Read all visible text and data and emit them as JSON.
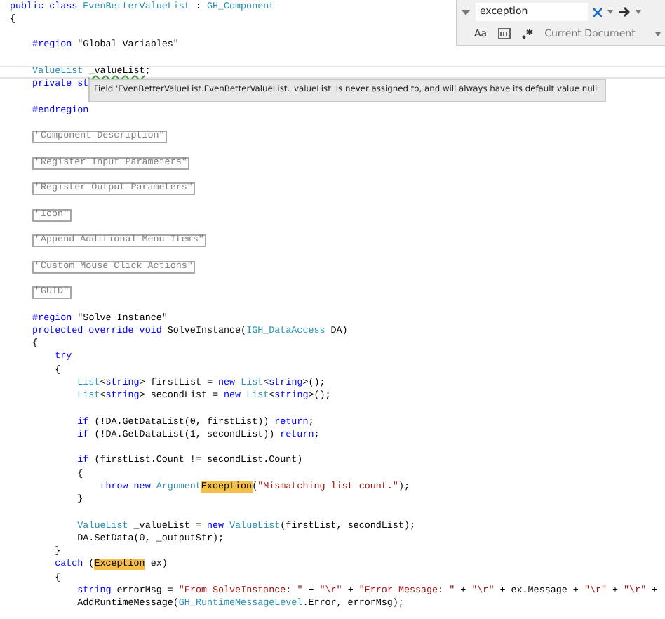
{
  "editor": {
    "lines": [
      {
        "tokens": [
          {
            "kind": "kw",
            "text": "public class "
          },
          {
            "kind": "type",
            "text": "EvenBetterValueList"
          },
          {
            "kind": "plain",
            "text": " : "
          },
          {
            "kind": "type",
            "text": "GH_Component"
          }
        ]
      },
      {
        "tokens": [
          {
            "kind": "plain",
            "text": "{"
          }
        ]
      },
      {
        "kind": "blank"
      },
      {
        "tokens": [
          {
            "kind": "kw",
            "text": "    #region "
          },
          {
            "kind": "plain",
            "text": "\"Global Variables\""
          }
        ]
      },
      {
        "kind": "blank"
      },
      {
        "current": true,
        "tokens": [
          {
            "kind": "type",
            "text": "    ValueList "
          },
          {
            "kind": "warn",
            "text": "_valueList"
          },
          {
            "kind": "plain",
            "text": ";"
          }
        ]
      },
      {
        "tokens": [
          {
            "kind": "kw",
            "text": "    private st"
          }
        ]
      },
      {
        "kind": "blank"
      },
      {
        "tokens": [
          {
            "kind": "kw",
            "text": "    #endregion"
          }
        ]
      },
      {
        "kind": "blank"
      },
      {
        "tokens": [
          {
            "kind": "collapsed",
            "text": "\"Component Description\""
          }
        ]
      },
      {
        "kind": "blank"
      },
      {
        "tokens": [
          {
            "kind": "collapsed",
            "text": "\"Register Input Parameters\""
          }
        ]
      },
      {
        "kind": "blank"
      },
      {
        "tokens": [
          {
            "kind": "collapsed",
            "text": "\"Register Output Parameters\""
          }
        ]
      },
      {
        "kind": "blank"
      },
      {
        "tokens": [
          {
            "kind": "collapsed",
            "text": "\"Icon\""
          }
        ]
      },
      {
        "kind": "blank"
      },
      {
        "tokens": [
          {
            "kind": "collapsed",
            "text": "\"Append Additional Menu Items\""
          }
        ]
      },
      {
        "kind": "blank"
      },
      {
        "tokens": [
          {
            "kind": "collapsed",
            "text": "\"Custom Mouse Click Actions\""
          }
        ]
      },
      {
        "kind": "blank"
      },
      {
        "tokens": [
          {
            "kind": "collapsed",
            "text": "\"GUID\""
          }
        ]
      },
      {
        "kind": "blank"
      },
      {
        "tokens": [
          {
            "kind": "kw",
            "text": "    #region "
          },
          {
            "kind": "plain",
            "text": "\"Solve Instance\""
          }
        ]
      },
      {
        "tokens": [
          {
            "kind": "kw",
            "text": "    protected override void "
          },
          {
            "kind": "plain",
            "text": "SolveInstance("
          },
          {
            "kind": "type",
            "text": "IGH_DataAccess"
          },
          {
            "kind": "plain",
            "text": " DA)"
          }
        ]
      },
      {
        "tokens": [
          {
            "kind": "plain",
            "text": "    {"
          }
        ]
      },
      {
        "tokens": [
          {
            "kind": "kw",
            "text": "        try"
          }
        ]
      },
      {
        "tokens": [
          {
            "kind": "plain",
            "text": "        {"
          }
        ]
      },
      {
        "tokens": [
          {
            "kind": "type",
            "text": "            List"
          },
          {
            "kind": "plain",
            "text": "<"
          },
          {
            "kind": "kw",
            "text": "string"
          },
          {
            "kind": "plain",
            "text": "> firstList = "
          },
          {
            "kind": "kw",
            "text": "new "
          },
          {
            "kind": "type",
            "text": "List"
          },
          {
            "kind": "plain",
            "text": "<"
          },
          {
            "kind": "kw",
            "text": "string"
          },
          {
            "kind": "plain",
            "text": ">();"
          }
        ]
      },
      {
        "tokens": [
          {
            "kind": "type",
            "text": "            List"
          },
          {
            "kind": "plain",
            "text": "<"
          },
          {
            "kind": "kw",
            "text": "string"
          },
          {
            "kind": "plain",
            "text": "> secondList = "
          },
          {
            "kind": "kw",
            "text": "new "
          },
          {
            "kind": "type",
            "text": "List"
          },
          {
            "kind": "plain",
            "text": "<"
          },
          {
            "kind": "kw",
            "text": "string"
          },
          {
            "kind": "plain",
            "text": ">();"
          }
        ]
      },
      {
        "kind": "blank"
      },
      {
        "tokens": [
          {
            "kind": "kw",
            "text": "            if"
          },
          {
            "kind": "plain",
            "text": " (!DA.GetDataList(0, firstList)) "
          },
          {
            "kind": "kw",
            "text": "return"
          },
          {
            "kind": "plain",
            "text": ";"
          }
        ]
      },
      {
        "tokens": [
          {
            "kind": "kw",
            "text": "            if"
          },
          {
            "kind": "plain",
            "text": " (!DA.GetDataList(1, secondList)) "
          },
          {
            "kind": "kw",
            "text": "return"
          },
          {
            "kind": "plain",
            "text": ";"
          }
        ]
      },
      {
        "kind": "blank"
      },
      {
        "tokens": [
          {
            "kind": "kw",
            "text": "            if"
          },
          {
            "kind": "plain",
            "text": " (firstList.Count != secondList.Count)"
          }
        ]
      },
      {
        "tokens": [
          {
            "kind": "plain",
            "text": "            {"
          }
        ]
      },
      {
        "tokens": [
          {
            "kind": "kw",
            "text": "                throw new "
          },
          {
            "kind": "type",
            "text": "Argument"
          },
          {
            "kind": "match",
            "text": "Exception"
          },
          {
            "kind": "plain",
            "text": "("
          },
          {
            "kind": "str",
            "text": "\"Mismatching list count.\""
          },
          {
            "kind": "plain",
            "text": ");"
          }
        ]
      },
      {
        "tokens": [
          {
            "kind": "plain",
            "text": "            }"
          }
        ]
      },
      {
        "kind": "blank"
      },
      {
        "tokens": [
          {
            "kind": "type",
            "text": "            ValueList"
          },
          {
            "kind": "plain",
            "text": " _valueList = "
          },
          {
            "kind": "kw",
            "text": "new "
          },
          {
            "kind": "type",
            "text": "ValueList"
          },
          {
            "kind": "plain",
            "text": "(firstList, secondList);"
          }
        ]
      },
      {
        "tokens": [
          {
            "kind": "plain",
            "text": "            DA.SetData(0, _outputStr);"
          }
        ]
      },
      {
        "tokens": [
          {
            "kind": "plain",
            "text": "        }"
          }
        ]
      },
      {
        "tokens": [
          {
            "kind": "kw",
            "text": "        catch"
          },
          {
            "kind": "plain",
            "text": " ("
          },
          {
            "kind": "match",
            "text": "Exception"
          },
          {
            "kind": "plain",
            "text": " ex)"
          }
        ]
      },
      {
        "tokens": [
          {
            "kind": "plain",
            "text": "        {"
          }
        ]
      },
      {
        "tokens": [
          {
            "kind": "kw",
            "text": "            string"
          },
          {
            "kind": "plain",
            "text": " errorMsg = "
          },
          {
            "kind": "str",
            "text": "\"From SolveInstance: \""
          },
          {
            "kind": "plain",
            "text": " + "
          },
          {
            "kind": "str",
            "text": "\"\\r\""
          },
          {
            "kind": "plain",
            "text": " + "
          },
          {
            "kind": "str",
            "text": "\"Error Message: \""
          },
          {
            "kind": "plain",
            "text": " + "
          },
          {
            "kind": "str",
            "text": "\"\\r\""
          },
          {
            "kind": "plain",
            "text": " + ex.Message + "
          },
          {
            "kind": "str",
            "text": "\"\\r\""
          },
          {
            "kind": "plain",
            "text": " + "
          },
          {
            "kind": "str",
            "text": "\"\\r\""
          },
          {
            "kind": "plain",
            "text": " +"
          }
        ]
      },
      {
        "tokens": [
          {
            "kind": "plain",
            "text": "            AddRuntimeMessage("
          },
          {
            "kind": "type",
            "text": "GH_RuntimeMessageLevel"
          },
          {
            "kind": "plain",
            "text": ".Error, errorMsg);"
          }
        ]
      }
    ]
  },
  "tooltip": {
    "text": "Field 'EvenBetterValueList.EvenBetterValueList._valueList' is never assigned to, and will always have its default value null"
  },
  "find": {
    "query": "exception",
    "case_label": "Aa",
    "scope": "Current Document"
  }
}
